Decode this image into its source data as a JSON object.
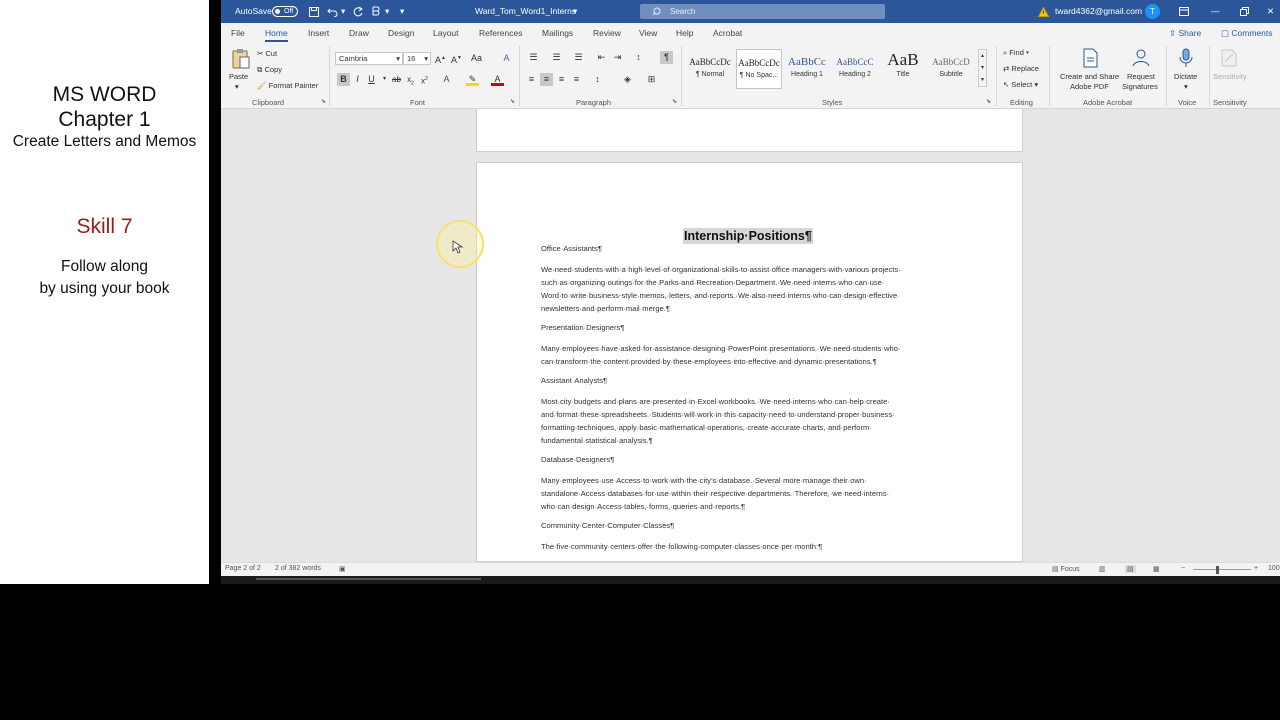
{
  "lesson": {
    "line1": "MS WORD",
    "line2": "Chapter 1",
    "line3": "Create Letters and Memos",
    "skill": "Skill 7",
    "follow1": "Follow along",
    "follow2": "by using your book"
  },
  "titlebar": {
    "autosave_label": "AutoSave",
    "autosave_state": "Off",
    "doc_title": "Ward_Tom_Word1_Interns",
    "search_placeholder": "Search",
    "user_email": "tward4362@gmail.com",
    "avatar_initial": "T"
  },
  "menu": {
    "tabs": [
      "File",
      "Home",
      "Insert",
      "Draw",
      "Design",
      "Layout",
      "References",
      "Mailings",
      "Review",
      "View",
      "Help",
      "Acrobat"
    ],
    "active_tab": "Home",
    "share": "Share",
    "comments": "Comments"
  },
  "ribbon": {
    "clipboard": {
      "paste": "Paste",
      "cut": "Cut",
      "copy": "Copy",
      "format_painter": "Format Painter",
      "group": "Clipboard"
    },
    "font": {
      "name": "Cambria",
      "size": "16",
      "group": "Font",
      "bold": "B",
      "italic": "I",
      "underline": "U"
    },
    "paragraph": {
      "group": "Paragraph"
    },
    "styles": {
      "group": "Styles",
      "items": [
        {
          "sample": "AaBbCcDc",
          "name": "¶ Normal"
        },
        {
          "sample": "AaBbCcDc",
          "name": "¶ No Spac..."
        },
        {
          "sample": "AaBbCc",
          "name": "Heading 1"
        },
        {
          "sample": "AaBbCcC",
          "name": "Heading 2"
        },
        {
          "sample": "AaB",
          "name": "Title"
        },
        {
          "sample": "AaBbCcD",
          "name": "Subtitle"
        }
      ]
    },
    "editing": {
      "find": "Find",
      "replace": "Replace",
      "select": "Select",
      "group": "Editing"
    },
    "acrobat": {
      "create": "Create and Share",
      "create2": "Adobe PDF",
      "request": "Request",
      "request2": "Signatures",
      "group": "Adobe Acrobat"
    },
    "voice": {
      "dictate": "Dictate",
      "group": "Voice"
    },
    "sensitivity": {
      "label": "Sensitivity",
      "group": "Sensitivity"
    }
  },
  "document": {
    "title": "Internship·Positions¶",
    "sections": [
      {
        "heading": "Office·Assistants¶",
        "body": "We·need·students·with·a·high·level·of·organizational·skills·to·assist·office·managers·with·various·projects·\nsuch·as·organizing·outings·for·the·Parks·and·Recreation·Department.·We·need·interns·who·can·use·\nWord·to·write·business-style·memos,·letters,·and·reports.·We·also·need·interns·who·can·design·effective·\nnewsletters·and·perform·mail·merge.¶"
      },
      {
        "heading": "Presentation·Designers¶",
        "body": "Many·employees·have·asked·for·assistance·designing·PowerPoint·presentations.·We·need·students·who·\ncan·transform·the·content·provided·by·these·employees·into·effective·and·dynamic·presentations.¶"
      },
      {
        "heading": "Assistant·Analysts¶",
        "body": "Most·city·budgets·and·plans·are·presented·in·Excel·workbooks.·We·need·interns·who·can·help·create·\nand·format·these·spreadsheets.·Students·will·work·in·this·capacity·need·to·understand·proper·business·\nformatting·techniques,·apply·basic·mathematical·operations,·create·accurate·charts,·and·perform·\nfundamental·statistical·analysis.¶"
      },
      {
        "heading": "Database·Designers¶",
        "body": "Many·employees·use·Access·to·work·with·the·city’s·database.·Several·more·manage·their·own·\nstandalone·Access·databases·for·use·within·their·respective·departments.·Therefore,·we·need·interns·\nwho·can·design·Access·tables,·forms,·queries·and·reports.¶"
      },
      {
        "heading": "Community·Center·Computer·Classes¶",
        "body": "The·five·community·centers·offer·the·following·computer·classes·once·per·month:¶"
      }
    ]
  },
  "status": {
    "page": "Page 2 of 2",
    "words": "2 of 382 words",
    "focus": "Focus",
    "zoom": "100"
  }
}
